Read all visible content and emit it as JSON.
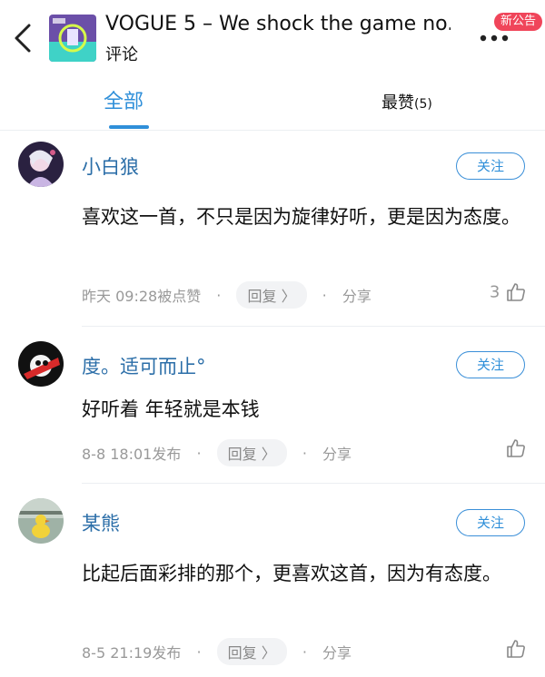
{
  "header": {
    "title": "VOGUE 5 – We shock the game no...",
    "subtitle": "评论",
    "badge": "新公告"
  },
  "tabs": {
    "all_label": "全部",
    "best_label": "最赞",
    "best_count": "(5)"
  },
  "comments": [
    {
      "name": "小白狼",
      "follow_label": "关注",
      "content": "喜欢这一首，不只是因为旋律好听，更是因为态度。",
      "time": "昨天 09:28被点赞",
      "reply_label": "回复 〉",
      "share_label": "分享",
      "likes": "3"
    },
    {
      "name": "度。适可而止°",
      "follow_label": "关注",
      "content": "好听着  年轻就是本钱",
      "time": "8-8 18:01发布",
      "reply_label": "回复 〉",
      "share_label": "分享",
      "likes": ""
    },
    {
      "name": "某熊",
      "follow_label": "关注",
      "content": "比起后面彩排的那个，更喜欢这首，因为有态度。",
      "time": "8-5 21:19发布",
      "reply_label": "回复 〉",
      "share_label": "分享",
      "likes": ""
    }
  ],
  "colors": {
    "accent": "#2f8fd9",
    "name": "#2b6ea8",
    "badge": "#f0455a",
    "meta": "#999999"
  }
}
